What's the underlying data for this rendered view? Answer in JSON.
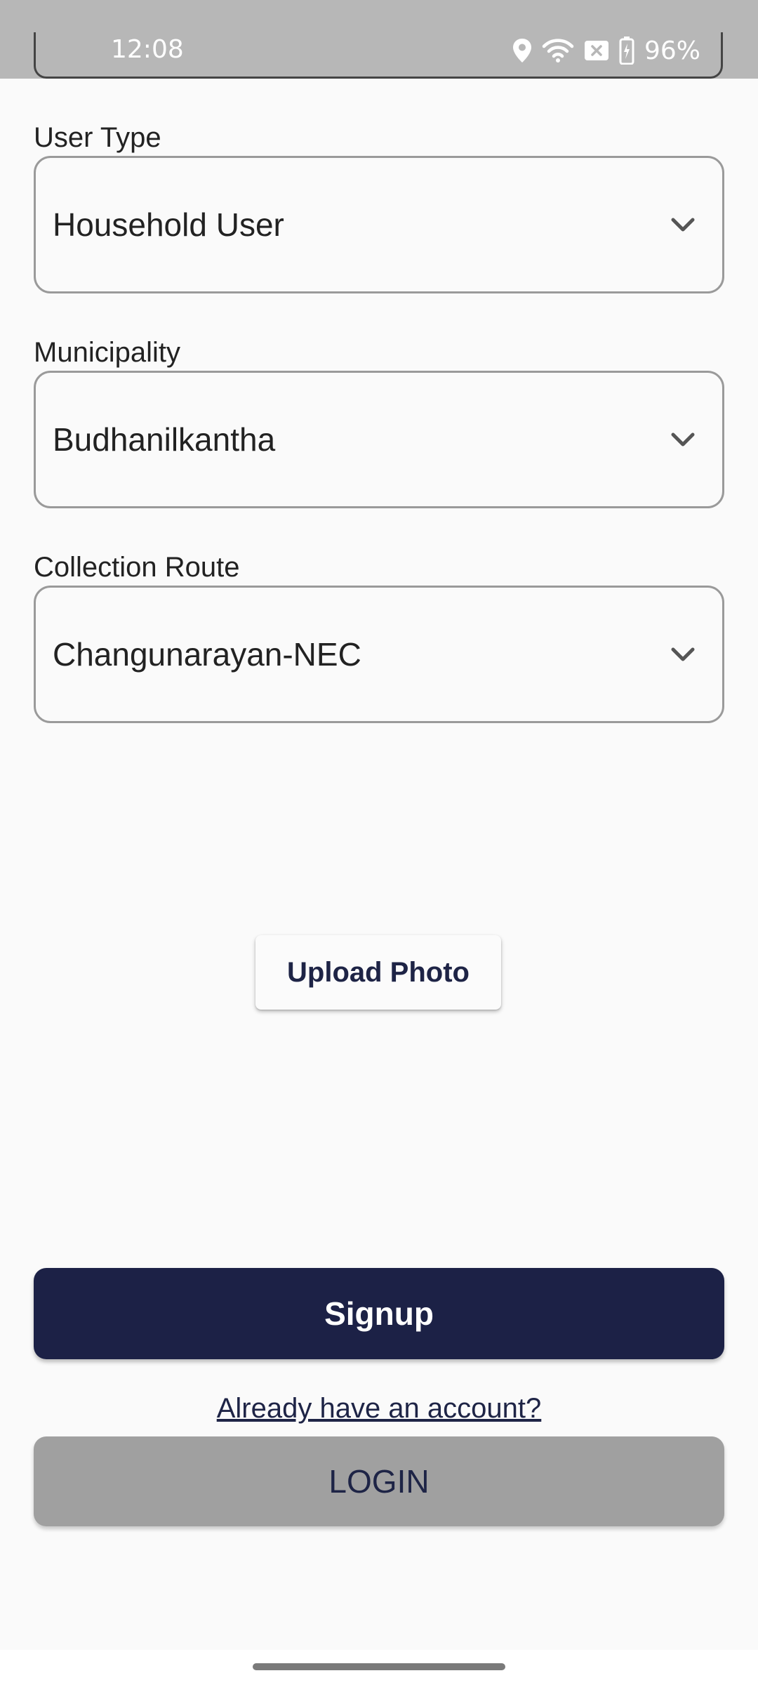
{
  "status_bar": {
    "time": "12:08",
    "battery": "96%",
    "icons": [
      "location-icon",
      "wifi-icon",
      "no-sim-icon",
      "battery-charging-icon"
    ]
  },
  "form": {
    "user_type": {
      "label": "User Type",
      "value": "Household User"
    },
    "municipality": {
      "label": "Municipality",
      "value": "Budhanilkantha"
    },
    "collection_route": {
      "label": "Collection Route",
      "value": "Changunarayan-NEC"
    },
    "upload_photo_label": "Upload Photo",
    "signup_label": "Signup",
    "account_link_label": "Already have an account?",
    "login_label": "LOGIN"
  },
  "colors": {
    "primary": "#1c2146",
    "login_button": "#a0a0a0",
    "background": "#fafafa"
  }
}
